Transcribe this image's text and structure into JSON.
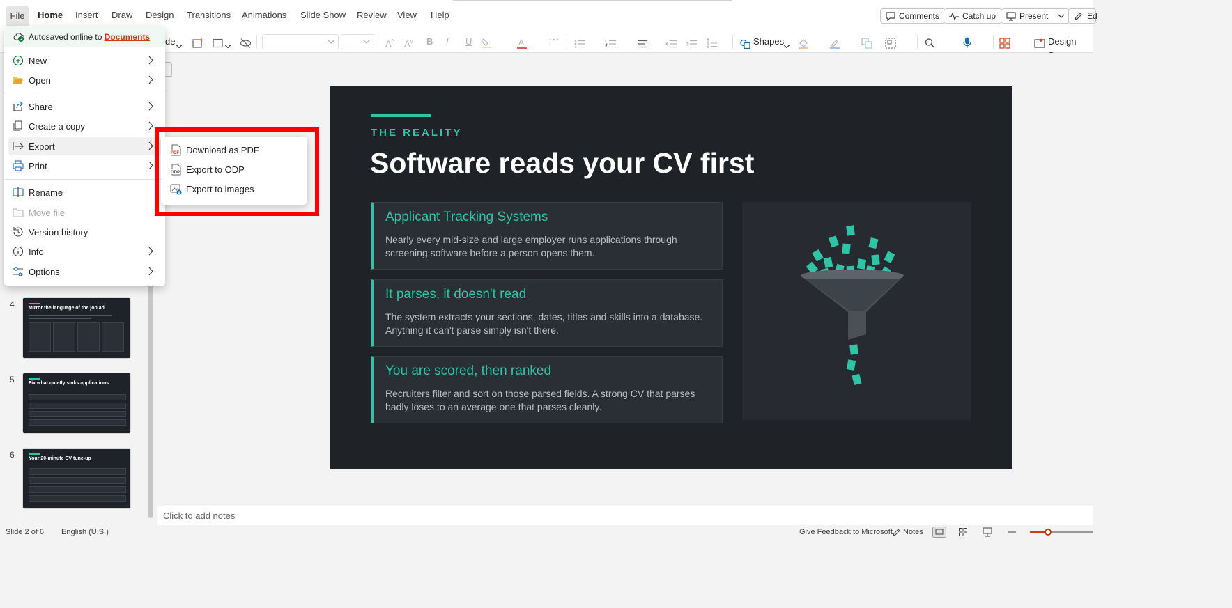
{
  "ribbon": {
    "tabs": [
      "File",
      "Home",
      "Insert",
      "Draw",
      "Design",
      "Transitions",
      "Animations",
      "Slide Show",
      "Review",
      "View",
      "Help"
    ],
    "comments_label": "Comments",
    "catchup_label": "Catch up",
    "present_label": "Present",
    "edit_label": "Ed"
  },
  "toolbar": {
    "layout_fragment": "de",
    "shapes_label": "Shapes",
    "design_label": "Design Sugg"
  },
  "file_menu": {
    "autosave_text": "Autosaved online to",
    "autosave_link": "Documents",
    "items": [
      {
        "label": "New"
      },
      {
        "label": "Open"
      },
      {
        "label": "Share"
      },
      {
        "label": "Create a copy"
      },
      {
        "label": "Export"
      },
      {
        "label": "Print"
      },
      {
        "label": "Rename"
      },
      {
        "label": "Move file"
      },
      {
        "label": "Version history"
      },
      {
        "label": "Info"
      },
      {
        "label": "Options"
      }
    ]
  },
  "export_submenu": {
    "items": [
      {
        "label": "Download as PDF",
        "icon_text": "PDF"
      },
      {
        "label": "Export to ODP",
        "icon_text": "ODP"
      },
      {
        "label": "Export to images"
      }
    ]
  },
  "thumbnails": [
    {
      "number": "4",
      "title": "Mirror the language of the job ad"
    },
    {
      "number": "5",
      "title": "Fix what quietly sinks applications"
    },
    {
      "number": "6",
      "title": "Your 20-minute CV tune-up"
    }
  ],
  "slide": {
    "kicker": "THE REALITY",
    "title": "Software reads your CV first",
    "cards": [
      {
        "heading": "Applicant Tracking Systems",
        "body": "Nearly every mid-size and large employer runs applications through screening software before a person opens them."
      },
      {
        "heading": "It parses, it doesn't read",
        "body": "The system extracts your sections, dates, titles and skills into a database. Anything it can't parse simply isn't there."
      },
      {
        "heading": "You are scored, then ranked",
        "body": "Recruiters filter and sort on those parsed fields. A strong CV that parses badly loses to an average one that parses cleanly."
      }
    ]
  },
  "notes_placeholder": "Click to add notes",
  "status": {
    "slide_counter": "Slide 2 of 6",
    "language": "English (U.S.)",
    "feedback": "Give Feedback to Microsoft",
    "notes": "Notes"
  },
  "colors": {
    "accent": "#2ec4a6",
    "slide_bg": "#1f2226",
    "highlight": "#ff0000",
    "link": "#c43e1c"
  }
}
